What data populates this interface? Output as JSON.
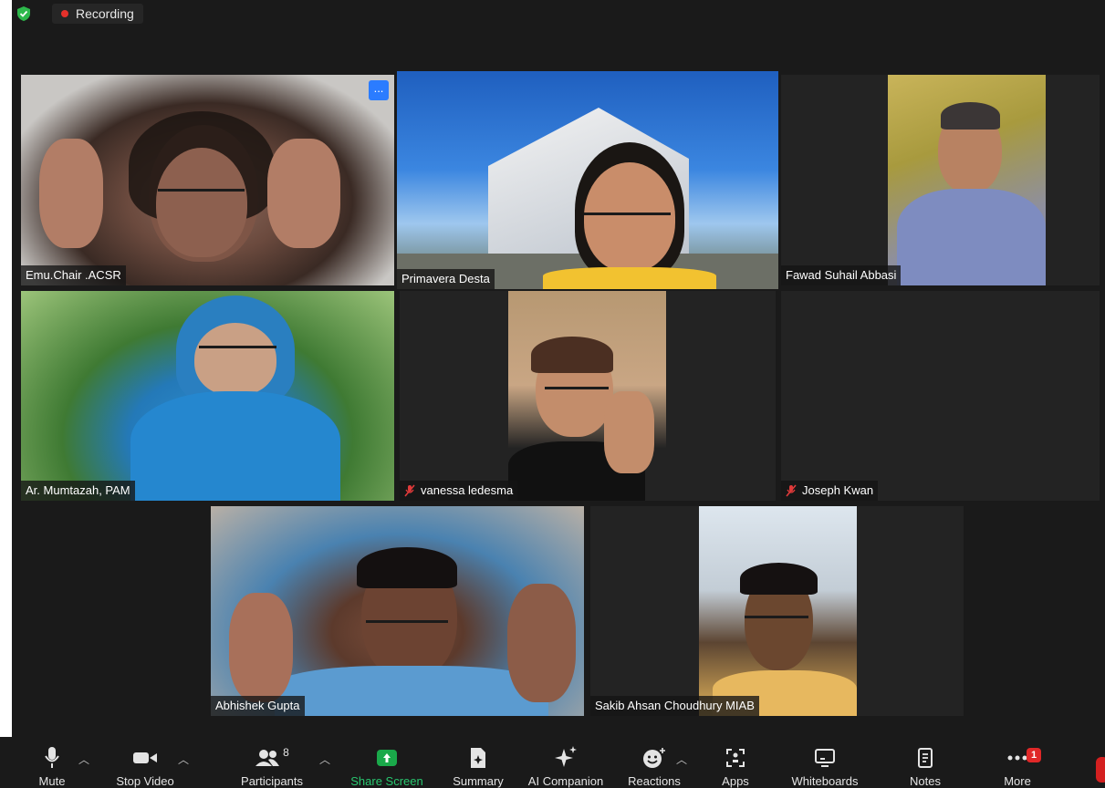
{
  "recording": {
    "label": "Recording",
    "status_color": "#e5312b"
  },
  "participants": [
    {
      "name": "Emu.Chair .ACSR",
      "muted": false
    },
    {
      "name": "Primavera Desta",
      "muted": false,
      "active_speaker": true
    },
    {
      "name": "Fawad Suhail Abbasi",
      "muted": false
    },
    {
      "name": "Ar. Mumtazah, PAM",
      "muted": false
    },
    {
      "name": "vanessa ledesma",
      "muted": true
    },
    {
      "name": "Joseph Kwan",
      "muted": true
    },
    {
      "name": "Abhishek Gupta",
      "muted": false
    },
    {
      "name": "Sakib Ahsan Choudhury MIAB",
      "muted": false
    }
  ],
  "tile_menu_label": "...",
  "toolbar": {
    "mute": "Mute",
    "stop_video": "Stop Video",
    "participants": "Participants",
    "participants_count": "8",
    "share_screen": "Share Screen",
    "summary": "Summary",
    "ai_companion": "AI Companion",
    "reactions": "Reactions",
    "apps": "Apps",
    "whiteboards": "Whiteboards",
    "notes": "Notes",
    "more": "More",
    "more_badge": "1"
  },
  "colors": {
    "active_speaker_border": "#c8e35b",
    "share_green": "#1aa94a",
    "badge_red": "#e02828"
  }
}
